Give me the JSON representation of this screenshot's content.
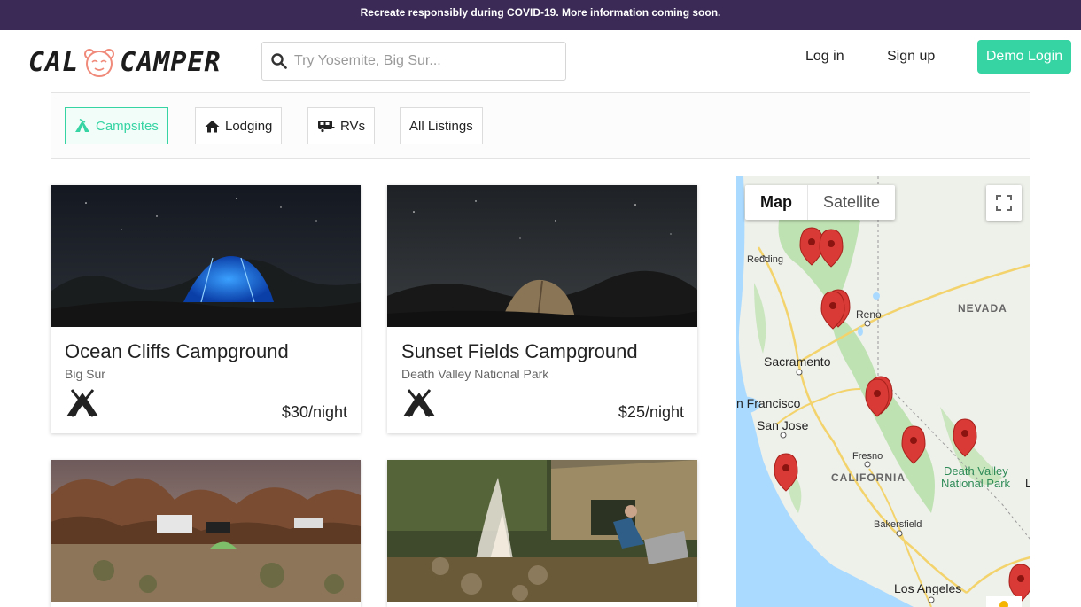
{
  "banner": {
    "text": "Recreate responsibly during COVID-19. More information coming soon."
  },
  "header": {
    "logo_left": "CAL",
    "logo_right": "CAMPER",
    "search_placeholder": "Try Yosemite, Big Sur...",
    "login": "Log in",
    "signup": "Sign up",
    "demo_login": "Demo Login"
  },
  "filters": [
    {
      "label": "Campsites",
      "icon": "tent-icon",
      "active": true
    },
    {
      "label": "Lodging",
      "icon": "house-icon",
      "active": false
    },
    {
      "label": "RVs",
      "icon": "rv-icon",
      "active": false
    },
    {
      "label": "All Listings",
      "icon": "",
      "active": false
    }
  ],
  "listings": [
    {
      "title": "Ocean Cliffs Campground",
      "location": "Big Sur",
      "price": "$30/night",
      "icon": "tent-icon"
    },
    {
      "title": "Sunset Fields Campground",
      "location": "Death Valley National Park",
      "price": "$25/night",
      "icon": "tent-icon"
    },
    {
      "title": "",
      "location": "",
      "price": ""
    },
    {
      "title": "",
      "location": "",
      "price": ""
    }
  ],
  "map": {
    "type_map": "Map",
    "type_satellite": "Satellite",
    "labels": {
      "redding": "Redding",
      "reno": "Reno",
      "nevada": "NEVADA",
      "sacramento": "Sacramento",
      "san_francisco": "n Francisco",
      "san_jose": "San Jose",
      "fresno": "Fresno",
      "california": "CALIFORNIA",
      "death_valley_1": "Death Valley",
      "death_valley_2": "National Park",
      "bakersfield": "Bakersfield",
      "los_angeles": "Los Angeles",
      "edge_letter": "L"
    }
  },
  "colors": {
    "banner": "#3a2a55",
    "accent": "#36d4a3",
    "marker": "#d93a35"
  }
}
